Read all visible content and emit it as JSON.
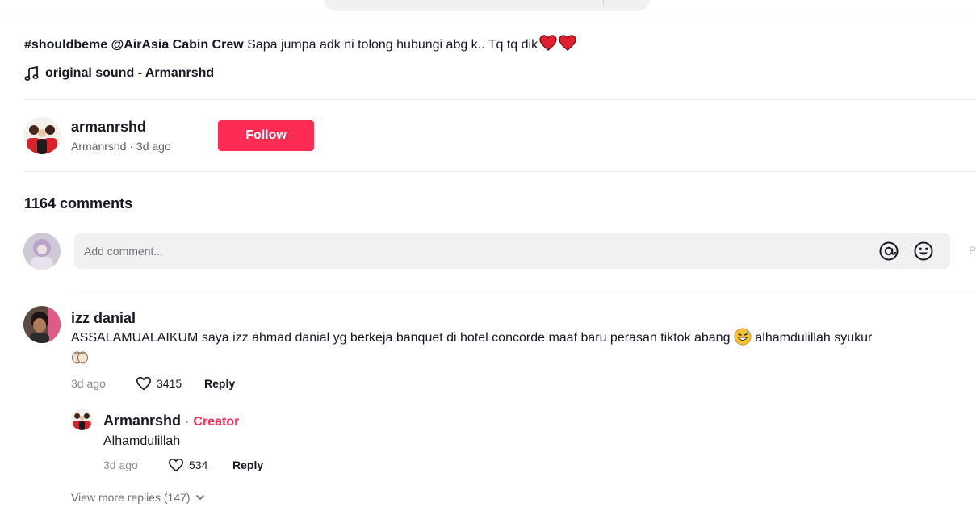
{
  "video": {
    "hashtag": "#shouldbeme",
    "mention": "@AirAsia Cabin Crew",
    "caption": " Sapa jumpa adk ni tolong hubungi abg k.. Tq tq dik",
    "sound": "original sound - Armanrshd"
  },
  "author": {
    "username": "armanrshd",
    "nickname": "Armanrshd",
    "posted": "3d ago",
    "follow_label": "Follow"
  },
  "comments_header": {
    "count_label": "1164 comments",
    "input_placeholder": "Add comment...",
    "post_label": "P"
  },
  "comments": [
    {
      "username": "izz danial",
      "text": "ASSALAMUALAIKUM saya izz ahmad danial yg berkeja banquet di hotel concorde maaf baru perasan tiktok abang",
      "text_after_emoji": " alhamdulillah syukur",
      "date": "3d ago",
      "likes": "3415",
      "reply_label": "Reply",
      "replies": [
        {
          "username": "Armanrshd",
          "separator": "·",
          "badge": "Creator",
          "text": "Alhamdulillah",
          "date": "3d ago",
          "likes": "534",
          "reply_label": "Reply"
        }
      ],
      "view_more": "View more replies (147)"
    }
  ],
  "colors": {
    "accent": "#fe2c55",
    "heart_emoji": "#e0202e",
    "text": "#161823",
    "muted": "#8a8b91"
  },
  "icons": [
    "music-note-icon",
    "at-mention-icon",
    "emoji-icon",
    "heart-outline-icon",
    "chevron-down-icon",
    "grinning-sweat-emoji",
    "praying-hands-emoji",
    "red-heart-emoji"
  ]
}
